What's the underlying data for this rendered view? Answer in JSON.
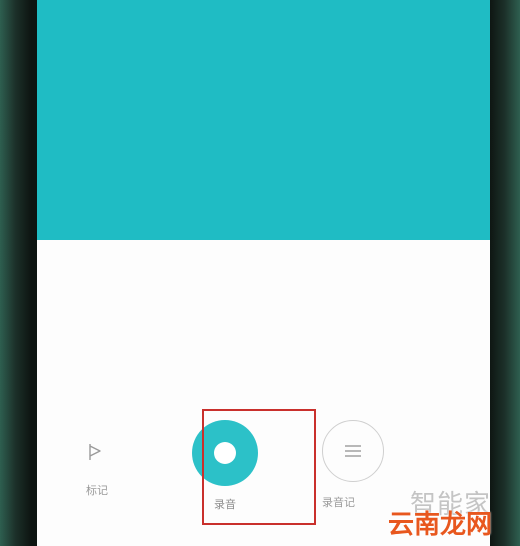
{
  "controls": {
    "mark_label": "标记",
    "record_label": "录音",
    "list_label": "录音记"
  },
  "watermark": {
    "top_text": "智能家",
    "bottom_text": "云南龙网"
  },
  "colors": {
    "top_panel": "#1fbcc4",
    "record_button": "#2cc1c8",
    "highlight_box": "#c9302c",
    "watermark_orange": "#e8571e"
  },
  "icons": {
    "mark": "flag-icon",
    "record": "record-icon",
    "list": "list-icon"
  }
}
